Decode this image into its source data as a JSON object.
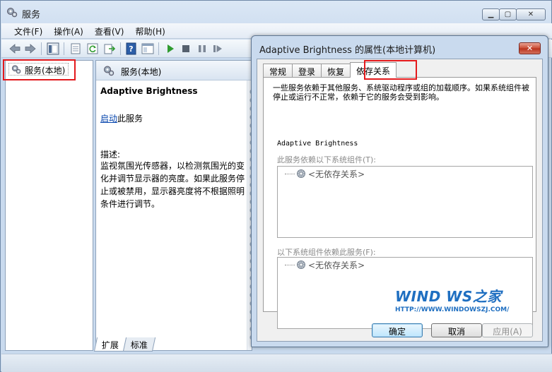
{
  "main_window": {
    "title": "服务",
    "icon": "services-gear-icon",
    "caption_buttons": {
      "minimize": "minimize-icon",
      "maximize": "maximize-icon",
      "close": "close-icon"
    }
  },
  "menubar": {
    "items": [
      {
        "label": "文件(F)"
      },
      {
        "label": "操作(A)"
      },
      {
        "label": "查看(V)"
      },
      {
        "label": "帮助(H)"
      }
    ]
  },
  "toolbar": {
    "buttons": [
      "back-arrow-icon",
      "forward-arrow-icon",
      "console-tree-icon",
      "properties-icon",
      "refresh-icon",
      "export-list-icon",
      "help-icon",
      "console-window-icon",
      "play-icon",
      "stop-icon",
      "pause-icon",
      "restart-icon"
    ]
  },
  "tree": {
    "root_label": "服务(本地)"
  },
  "middle_pane": {
    "header": "服务(本地)",
    "service_name": "Adaptive Brightness",
    "start_link": "启动",
    "start_suffix": "此服务",
    "desc_label": "描述:",
    "description": "监视氛围光传感器，以检测氛围光的变化并调节显示器的亮度。如果此服务停止或被禁用，显示器亮度将不根据照明条件进行调节。",
    "tabs": [
      "扩展",
      "标准"
    ]
  },
  "dialog": {
    "title": "Adaptive Brightness 的属性(本地计算机)",
    "tabs": [
      "常规",
      "登录",
      "恢复",
      "依存关系"
    ],
    "active_tab": "依存关系",
    "intro": "一些服务依赖于其他服务、系统驱动程序或组的加载顺序。如果系统组件被停止或运行不正常，依赖于它的服务会受到影响。",
    "service_title": "Adaptive Brightness",
    "depends_on_label": "此服务依赖以下系统组件(T):",
    "depends_on_entry": "<无依存关系>",
    "dependents_label": "以下系统组件依赖此服务(F):",
    "dependents_entry": "<无依存关系>",
    "watermark_main": "WIND  WS之家",
    "watermark_url": "HTTP://WWW.WINDOWSZJ.COM/",
    "buttons": {
      "ok": "确定",
      "cancel": "取消",
      "apply": "应用(A)"
    }
  },
  "colors": {
    "highlight_box": "#e3191c",
    "link": "#0645ad",
    "watermark": "#1f6fc1"
  }
}
